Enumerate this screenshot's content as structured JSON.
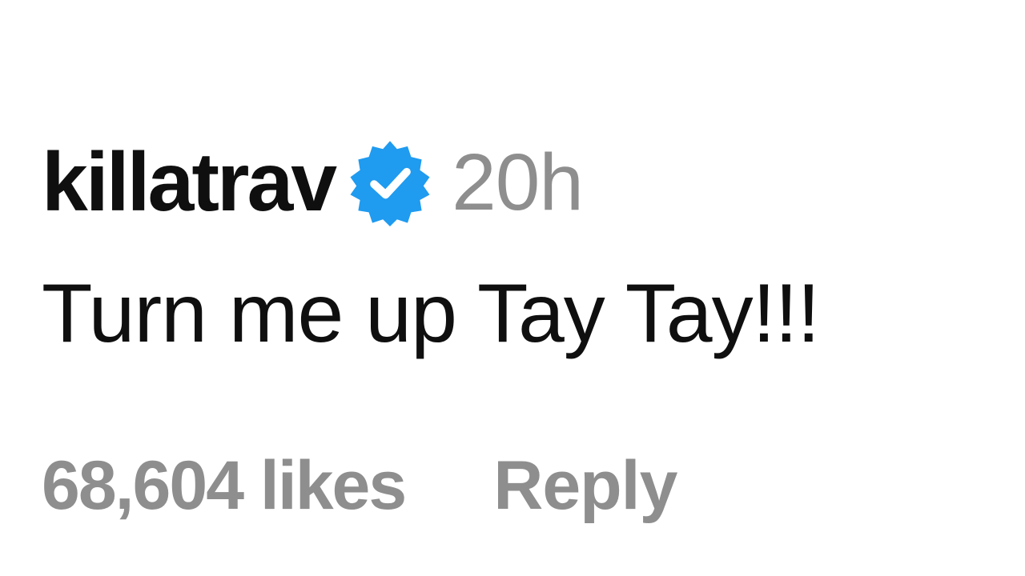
{
  "comment": {
    "username": "killatrav",
    "verified_icon": "verified-badge-icon",
    "badge_color": "#1f9bf0",
    "timestamp": "20h",
    "text": "Turn me up Tay Tay!!!",
    "likes": "68,604 likes",
    "reply_label": "Reply"
  }
}
